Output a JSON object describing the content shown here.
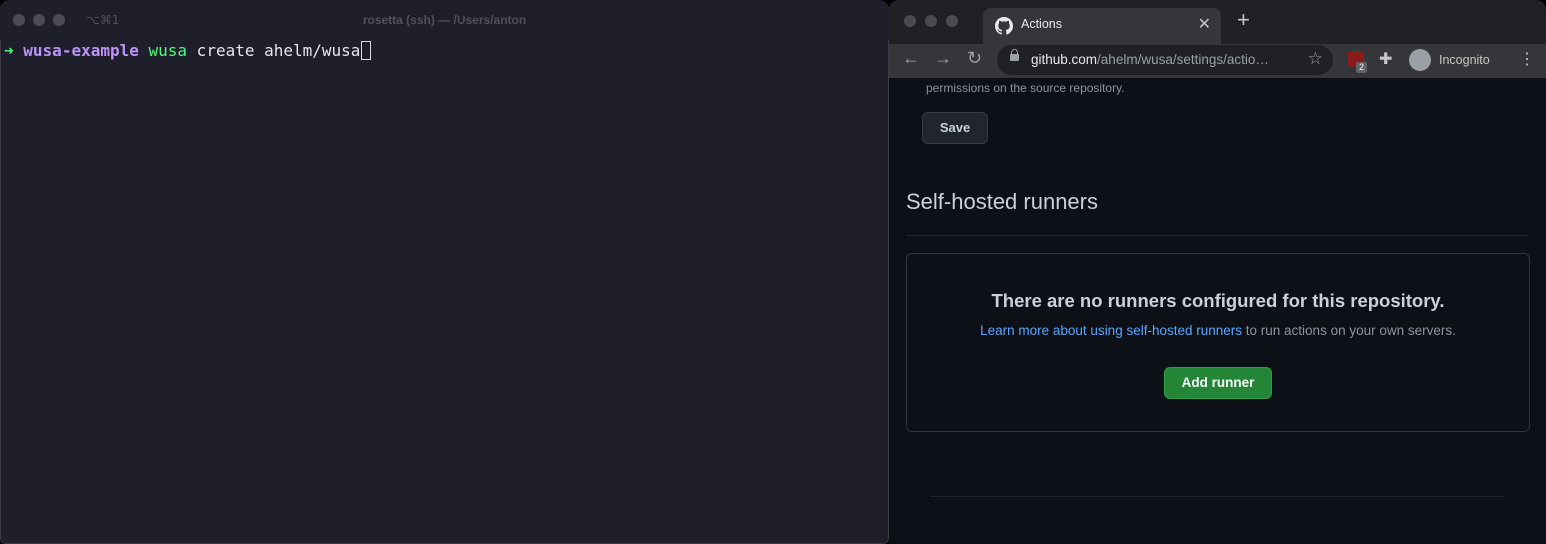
{
  "terminal": {
    "shortcut": "⌥⌘1",
    "title": "rosetta (ssh) — /Users/anton",
    "prompt_arrow": "➜",
    "directory": "wusa-example",
    "command": "wusa",
    "args": " create ahelm/wusa"
  },
  "browser": {
    "tab_title": "Actions",
    "tab_icon": "github-icon",
    "url_host": "github.com",
    "url_path": "/ahelm/wusa/settings/actio…",
    "extension_badge": "2",
    "profile_label": "Incognito"
  },
  "page": {
    "permissions_text": "permissions on the source repository.",
    "save_label": "Save",
    "runners_title": "Self-hosted runners",
    "empty_heading": "There are no runners configured for this repository.",
    "learn_more_link": "Learn more about using self-hosted runners",
    "learn_more_rest": " to run actions on your own servers.",
    "add_runner_label": "Add runner"
  },
  "colors": {
    "terminal_bg": "#1e1f2b",
    "prompt_green": "#50fa7b",
    "prompt_purple": "#bd93f9",
    "page_bg": "#0d1117",
    "link_blue": "#58a6ff",
    "button_green": "#238636"
  }
}
